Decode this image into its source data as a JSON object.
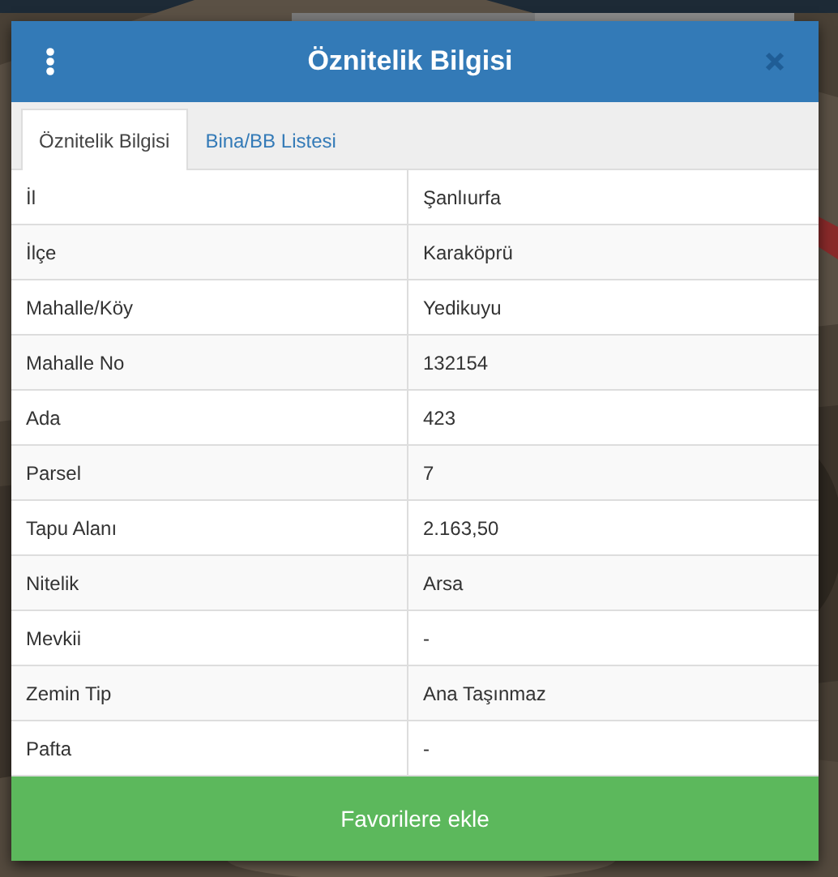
{
  "dialog": {
    "title": "Öznitelik Bilgisi",
    "tabs": [
      {
        "label": "Öznitelik Bilgisi",
        "selected": true
      },
      {
        "label": "Bina/BB Listesi",
        "selected": false
      }
    ],
    "rows": [
      {
        "label": "İl",
        "value": "Şanlıurfa"
      },
      {
        "label": "İlçe",
        "value": "Karaköprü"
      },
      {
        "label": "Mahalle/Köy",
        "value": "Yedikuyu"
      },
      {
        "label": "Mahalle No",
        "value": "132154"
      },
      {
        "label": "Ada",
        "value": "423"
      },
      {
        "label": "Parsel",
        "value": "7"
      },
      {
        "label": "Tapu Alanı",
        "value": "2.163,50"
      },
      {
        "label": "Nitelik",
        "value": "Arsa"
      },
      {
        "label": "Mevkii",
        "value": "-"
      },
      {
        "label": "Zemin Tip",
        "value": "Ana Taşınmaz"
      },
      {
        "label": "Pafta",
        "value": "-"
      }
    ],
    "button": "Favorilere ekle"
  }
}
